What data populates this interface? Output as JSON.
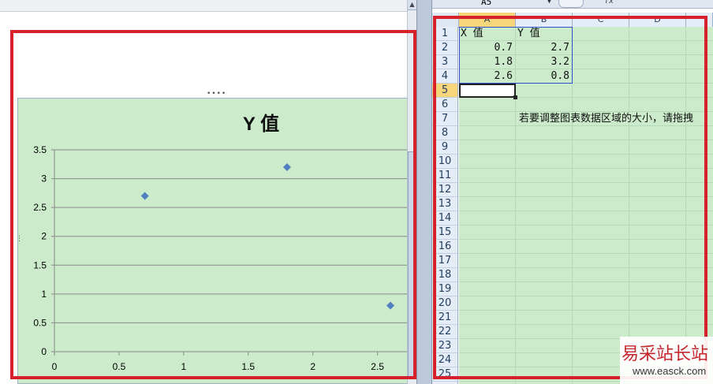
{
  "chart": {
    "title": "Y 值",
    "chart_data": {
      "type": "scatter",
      "title": "Y 值",
      "xlabel": "",
      "ylabel": "",
      "x": [
        0.7,
        1.8,
        2.6
      ],
      "y": [
        2.7,
        3.2,
        0.8
      ],
      "xlim": [
        0,
        2.6
      ],
      "ylim": [
        0,
        3.5
      ],
      "x_ticks": [
        "0",
        "0.5",
        "1",
        "1.5",
        "2",
        "2.5"
      ],
      "y_ticks": [
        "0",
        "0.5",
        "1",
        "1.5",
        "2",
        "2.5",
        "3",
        "3.5"
      ],
      "grid": "horizontal",
      "marker_color": "#4f7fbf"
    }
  },
  "sheet": {
    "name_box": "A5",
    "fx_label": "fx",
    "columns": [
      "A",
      "B",
      "C",
      "D"
    ],
    "rows": [
      "1",
      "2",
      "3",
      "4",
      "5",
      "6",
      "7",
      "8",
      "9",
      "10",
      "11",
      "12",
      "13",
      "14",
      "15",
      "16",
      "17",
      "18",
      "19",
      "20",
      "21",
      "22",
      "23",
      "24",
      "25"
    ],
    "header_row": {
      "a": "X 值",
      "b": "Y 值"
    },
    "data": [
      {
        "a": "0.7",
        "b": "2.7"
      },
      {
        "a": "1.8",
        "b": "3.2"
      },
      {
        "a": "2.6",
        "b": "0.8"
      }
    ],
    "note": "若要调整图表数据区域的大小，请拖拽"
  },
  "watermark": {
    "text": "易采站长站",
    "url": "www.easck.com"
  },
  "colors": {
    "annotation": "#d6202a",
    "chart_bg": "#cbebcb",
    "marker": "#4f7fbf"
  }
}
